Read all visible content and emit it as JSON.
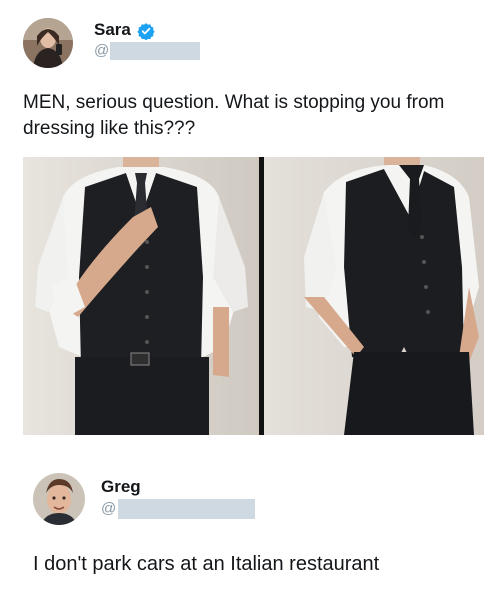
{
  "tweet1": {
    "author_name": "Sara",
    "handle_prefix": "@",
    "verified": true,
    "text": "MEN, serious question. What is stopping you from dressing like this???",
    "media": [
      "vest-outfit-front-photo",
      "vest-outfit-angle-photo"
    ]
  },
  "tweet2": {
    "author_name": "Greg",
    "handle_prefix": "@",
    "text": "I don't park cars at an Italian restaurant"
  },
  "colors": {
    "verified_blue": "#1da1f2",
    "redaction": "#cfd9e2",
    "text": "#14171a",
    "muted": "#8899a6"
  }
}
